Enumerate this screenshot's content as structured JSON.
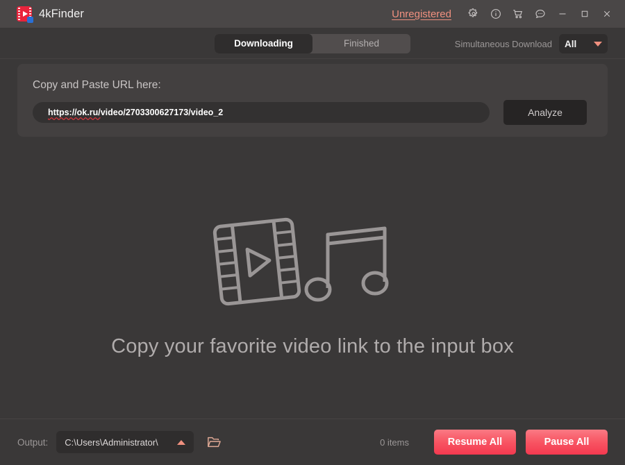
{
  "window": {
    "app_title": "4kFinder",
    "logo_icon": "app-logo-film-play-icon",
    "unregistered_label": "Unregistered",
    "icons": {
      "settings": "gear-icon",
      "info": "info-circle-icon",
      "cart": "shopping-cart-icon",
      "feedback": "chat-bubble-icon",
      "minimize": "minimize-icon",
      "maximize": "maximize-icon",
      "close": "close-icon"
    }
  },
  "toolbar": {
    "tabs": [
      {
        "label": "Downloading",
        "active": true
      },
      {
        "label": "Finished",
        "active": false
      }
    ],
    "simultaneous_label": "Simultaneous Download",
    "simultaneous_value": "All",
    "simultaneous_options": [
      "All"
    ]
  },
  "url_card": {
    "label": "Copy and Paste URL here:",
    "input_value": "https://ok.ru/video/2703300627173/video_2",
    "input_misspelled_part": "https://ok.ru/",
    "input_rest": "video/2703300627173/video_2",
    "input_placeholder": "Copy and Paste URL here",
    "analyze_label": "Analyze"
  },
  "empty_state": {
    "message": "Copy your favorite video link to the input box",
    "art_icons": [
      "film-strip-play-icon",
      "music-note-icon"
    ]
  },
  "footer": {
    "output_label": "Output:",
    "output_path": "C:\\Users\\Administrator\\",
    "folder_icon": "open-folder-icon",
    "items_count": "0 items",
    "resume_all_label": "Resume All",
    "pause_all_label": "Pause All"
  },
  "colors": {
    "window_bg": "#3a3838",
    "titlebar_bg": "#4a4747",
    "card_bg": "#434040",
    "input_bg": "#333131",
    "accent_salmon": "#f0907f",
    "accent_red_button_top": "#fa7a84",
    "accent_red_button_bottom": "#f4394f",
    "logo_red": "#e8243c",
    "art_gray": "#9a9696",
    "text_primary": "#f0f0f0",
    "text_muted": "#9b9797"
  }
}
